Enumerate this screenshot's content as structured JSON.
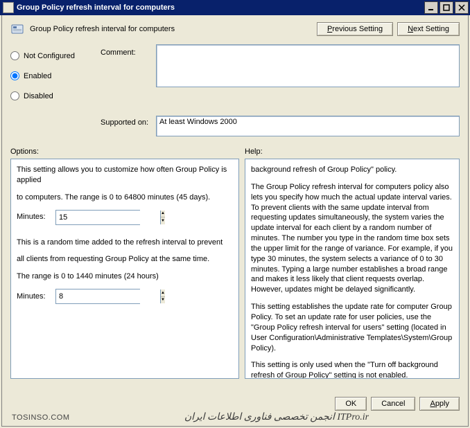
{
  "window": {
    "title": "Group Policy refresh interval for computers",
    "min_tip": "Minimize",
    "max_tip": "Maximize",
    "close_tip": "Close"
  },
  "header": {
    "policy_name": "Group Policy refresh interval for computers",
    "prev_label": "Previous Setting",
    "next_label": "Next Setting"
  },
  "state": {
    "not_configured_label": "Not Configured",
    "enabled_label": "Enabled",
    "disabled_label": "Disabled",
    "selected": "enabled"
  },
  "comment": {
    "label": "Comment:",
    "value": ""
  },
  "supported": {
    "label": "Supported on:",
    "value": "At least Windows 2000"
  },
  "panels": {
    "options_label": "Options:",
    "help_label": "Help:"
  },
  "options": {
    "p1": "This setting allows you to customize how often Group Policy is applied",
    "p2": "to computers. The range is 0 to 64800 minutes (45 days).",
    "minutes1_label": "Minutes:",
    "minutes1_value": "15",
    "p3": "This is a random time added to the refresh interval to prevent",
    "p4": "all clients from requesting Group Policy at the same time.",
    "p5": "The range is 0 to 1440 minutes (24 hours)",
    "minutes2_label": "Minutes:",
    "minutes2_value": "8"
  },
  "help": {
    "p1": "background refresh of Group Policy\" policy.",
    "p2": "The Group Policy refresh interval for computers policy also lets you specify how much the actual update interval varies. To prevent clients with the same update interval from requesting updates simultaneously, the system varies the update interval for each client by a random number of minutes. The number you type in the random time box sets the upper limit for the range of variance. For example, if you type 30 minutes, the system selects a variance of 0 to 30 minutes. Typing a large number establishes a broad range and makes it less likely that client requests overlap. However, updates might be delayed significantly.",
    "p3": "This setting establishes the update rate for computer Group Policy. To set an update rate for user policies, use the \"Group Policy refresh interval for users\" setting (located in User Configuration\\Administrative Templates\\System\\Group Policy).",
    "p4": "This setting is only used when the \"Turn off background refresh of Group Policy\" setting is not enabled."
  },
  "footer": {
    "ok": "OK",
    "cancel": "Cancel",
    "apply": "Apply"
  },
  "watermark": {
    "left": "TOSINSO.COM",
    "right": "انجمن تخصصی فناوری اطلاعات ایران ITPro.ir"
  }
}
